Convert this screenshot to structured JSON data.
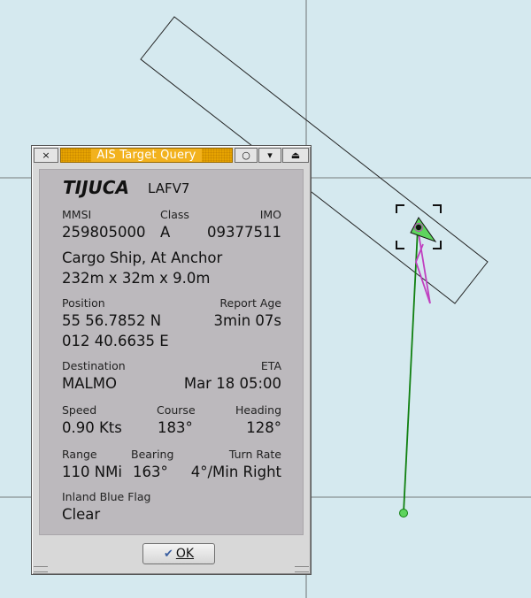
{
  "dialog": {
    "title": "AIS Target Query",
    "btn_close": "×",
    "btn_circle": "○",
    "btn_down": "▾",
    "btn_eject": "⏏",
    "ok_icon": "✔",
    "ok_label": "OK"
  },
  "target": {
    "name": "TIJUCA",
    "callsign": "LAFV7",
    "mmsi_label": "MMSI",
    "mmsi": "259805000",
    "class_label": "Class",
    "class": "A",
    "imo_label": "IMO",
    "imo": "09377511",
    "status": "Cargo Ship, At Anchor",
    "dimensions": "232m x 32m x 9.0m",
    "position_label": "Position",
    "lat": "55 56.7852 N",
    "lon": "012 40.6635 E",
    "report_age_label": "Report Age",
    "report_age": "3min 07s",
    "destination_label": "Destination",
    "destination": "MALMO",
    "eta_label": "ETA",
    "eta": "Mar 18 05:00",
    "speed_label": "Speed",
    "speed": "0.90 Kts",
    "course_label": "Course",
    "course": "183°",
    "heading_label": "Heading",
    "heading": "128°",
    "range_label": "Range",
    "range": "110 NMi",
    "bearing_label": "Bearing",
    "bearing": "163°",
    "turn_rate_label": "Turn Rate",
    "turn_rate": "4°/Min Right",
    "inland_label": "Inland Blue Flag",
    "inland": "Clear"
  },
  "colors": {
    "sea": "#d5e9ef",
    "target_fill": "#5ed45e",
    "cog_line": "#108010",
    "heading_line": "#c040c0",
    "title_bar": "#e6a300"
  }
}
